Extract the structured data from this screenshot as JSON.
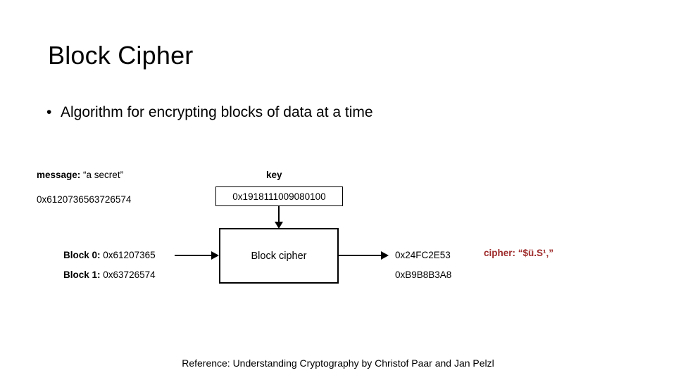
{
  "slide": {
    "title": "Block Cipher",
    "bullet_marker": "•",
    "bullet_text": "Algorithm for encrypting blocks of data at a time",
    "footer": "Reference: Understanding Cryptography by Christof Paar and Jan Pelzl"
  },
  "diagram": {
    "message": {
      "label_bold": "message:",
      "label_rest": " “a secret”",
      "hex": "0x6120736563726574"
    },
    "key": {
      "label": "key",
      "hex": "0x1918111009080100"
    },
    "blocks": [
      {
        "label": "Block 0:",
        "hex": " 0x61207365"
      },
      {
        "label": "Block 1:",
        "hex": " 0x63726574"
      }
    ],
    "process_box": {
      "label": "Block cipher"
    },
    "outputs": [
      {
        "hex": "0x24FC2E53"
      },
      {
        "hex": "0xB9B8B3A8"
      }
    ],
    "cipher_result": {
      "text": "cipher: “$ü.S¹‚”",
      "color": "#9e2a2a"
    },
    "arrows": {
      "key_to_box": "arrow-down",
      "blocks_to_box": "arrow-right",
      "box_to_outputs": "arrow-right"
    }
  },
  "colors": {
    "background": "#ffffff",
    "text": "#000000",
    "accent_red": "#9e2a2a",
    "stroke": "#000000"
  }
}
